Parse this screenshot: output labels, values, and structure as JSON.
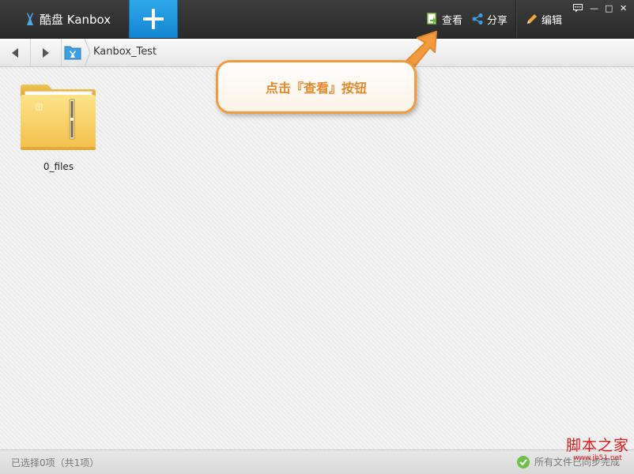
{
  "app": {
    "title": "酷盘 Kanbox"
  },
  "toolbar": {
    "view_label": "查看",
    "share_label": "分享",
    "edit_label": "编辑",
    "add_icon": "plus-icon"
  },
  "window_controls": {
    "feedback_icon": "chat-icon",
    "minimize_glyph": "—",
    "maximize_glyph": "□",
    "close_glyph": "✕"
  },
  "breadcrumb": {
    "current": "Kanbox_Test"
  },
  "files": [
    {
      "name": "0_files",
      "type": "folder"
    }
  ],
  "callout": {
    "text": "点击『查看』按钮"
  },
  "status": {
    "selection": "已选择0项（共1项）",
    "sync": "所有文件已同步完成"
  },
  "watermark": {
    "main": "脚本之家",
    "sub": "www.jb51.net"
  },
  "colors": {
    "accent_blue": "#1e96dd",
    "callout_orange": "#f39a3c",
    "folder_yellow": "#f7c64a",
    "watermark_red": "#e21a1a"
  }
}
